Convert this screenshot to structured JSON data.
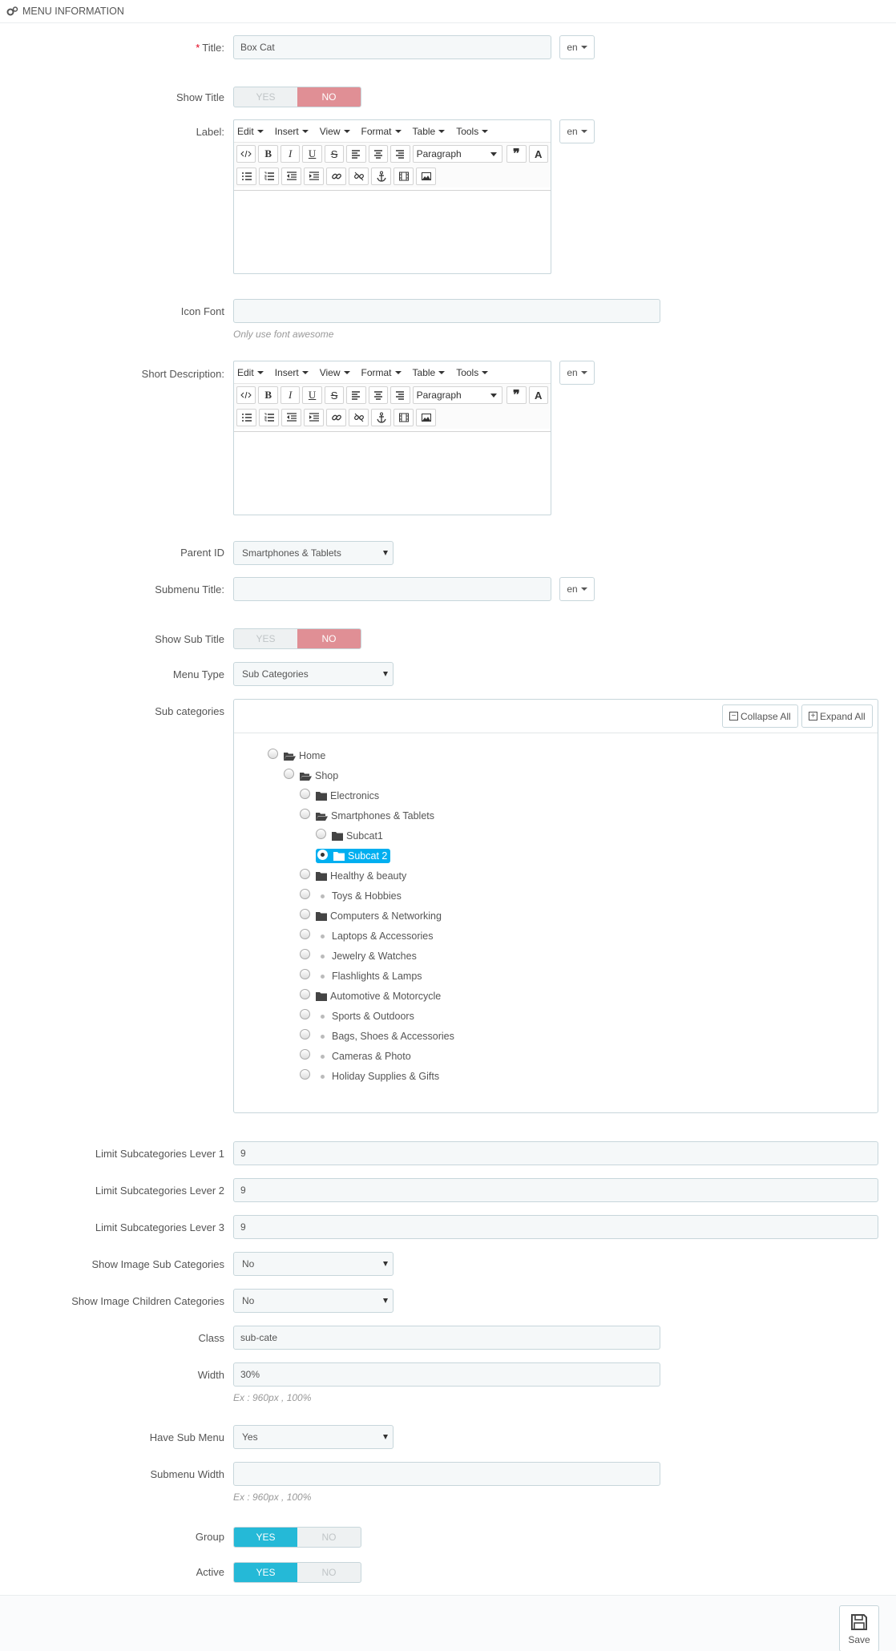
{
  "panel": {
    "title": "MENU INFORMATION",
    "icon": "gears-icon"
  },
  "fields": {
    "title": {
      "label": "Title:",
      "required_mark": "*",
      "value": "Box Cat",
      "lang": "en"
    },
    "show_title": {
      "label": "Show Title",
      "yes": "YES",
      "no": "NO",
      "value": "NO"
    },
    "label": {
      "label": "Label:",
      "lang": "en"
    },
    "icon_font": {
      "label": "Icon Font",
      "value": "",
      "help": "Only use font awesome"
    },
    "short_description": {
      "label": "Short Description:",
      "lang": "en"
    },
    "parent_id": {
      "label": "Parent ID",
      "value": "Smartphones & Tablets"
    },
    "submenu_title": {
      "label": "Submenu Title:",
      "value": "",
      "lang": "en"
    },
    "show_sub_title": {
      "label": "Show Sub Title",
      "yes": "YES",
      "no": "NO",
      "value": "NO"
    },
    "menu_type": {
      "label": "Menu Type",
      "value": "Sub Categories"
    },
    "sub_categories": {
      "label": "Sub categories"
    },
    "limit_lv1": {
      "label": "Limit Subcategories Lever 1",
      "value": "9"
    },
    "limit_lv2": {
      "label": "Limit Subcategories Lever 2",
      "value": "9"
    },
    "limit_lv3": {
      "label": "Limit Subcategories Lever 3",
      "value": "9"
    },
    "show_image_sub": {
      "label": "Show Image Sub Categories",
      "value": "No"
    },
    "show_image_children": {
      "label": "Show Image Children Categories",
      "value": "No"
    },
    "class": {
      "label": "Class",
      "value": "sub-cate"
    },
    "width": {
      "label": "Width",
      "value": "30%",
      "help": "Ex : 960px , 100%"
    },
    "have_sub_menu": {
      "label": "Have Sub Menu",
      "value": "Yes"
    },
    "submenu_width": {
      "label": "Submenu Width",
      "value": "",
      "help": "Ex : 960px , 100%"
    },
    "group": {
      "label": "Group",
      "yes": "YES",
      "no": "NO",
      "value": "YES"
    },
    "active": {
      "label": "Active",
      "yes": "YES",
      "no": "NO",
      "value": "YES"
    }
  },
  "editor": {
    "menus": [
      "Edit",
      "Insert",
      "View",
      "Format",
      "Table",
      "Tools"
    ],
    "block_format": "Paragraph"
  },
  "tree": {
    "collapse_all": "Collapse All",
    "expand_all": "Expand All",
    "nodes": [
      {
        "label": "Home",
        "type": "folder-open",
        "depth": 0,
        "selected": false
      },
      {
        "label": "Shop",
        "type": "folder-open",
        "depth": 1,
        "selected": false
      },
      {
        "label": "Electronics",
        "type": "folder",
        "depth": 2,
        "selected": false
      },
      {
        "label": "Smartphones & Tablets",
        "type": "folder-open",
        "depth": 2,
        "selected": false
      },
      {
        "label": "Subcat1",
        "type": "folder",
        "depth": 3,
        "selected": false
      },
      {
        "label": "Subcat 2",
        "type": "folder",
        "depth": 3,
        "selected": true
      },
      {
        "label": "Healthy & beauty",
        "type": "folder",
        "depth": 2,
        "selected": false
      },
      {
        "label": "Toys & Hobbies",
        "type": "leaf",
        "depth": 2,
        "selected": false
      },
      {
        "label": "Computers & Networking",
        "type": "folder",
        "depth": 2,
        "selected": false
      },
      {
        "label": "Laptops & Accessories",
        "type": "leaf",
        "depth": 2,
        "selected": false
      },
      {
        "label": "Jewelry & Watches",
        "type": "leaf",
        "depth": 2,
        "selected": false
      },
      {
        "label": "Flashlights & Lamps",
        "type": "leaf",
        "depth": 2,
        "selected": false
      },
      {
        "label": "Automotive & Motorcycle",
        "type": "folder",
        "depth": 2,
        "selected": false
      },
      {
        "label": "Sports & Outdoors",
        "type": "leaf",
        "depth": 2,
        "selected": false
      },
      {
        "label": "Bags, Shoes & Accessories",
        "type": "leaf",
        "depth": 2,
        "selected": false
      },
      {
        "label": "Cameras & Photo",
        "type": "leaf",
        "depth": 2,
        "selected": false
      },
      {
        "label": "Holiday Supplies & Gifts",
        "type": "leaf",
        "depth": 2,
        "selected": false
      }
    ]
  },
  "footer": {
    "save": "Save"
  },
  "colors": {
    "accent": "#25b9d7",
    "no_active": "#e08f95",
    "tree_selected": "#00aff0"
  }
}
